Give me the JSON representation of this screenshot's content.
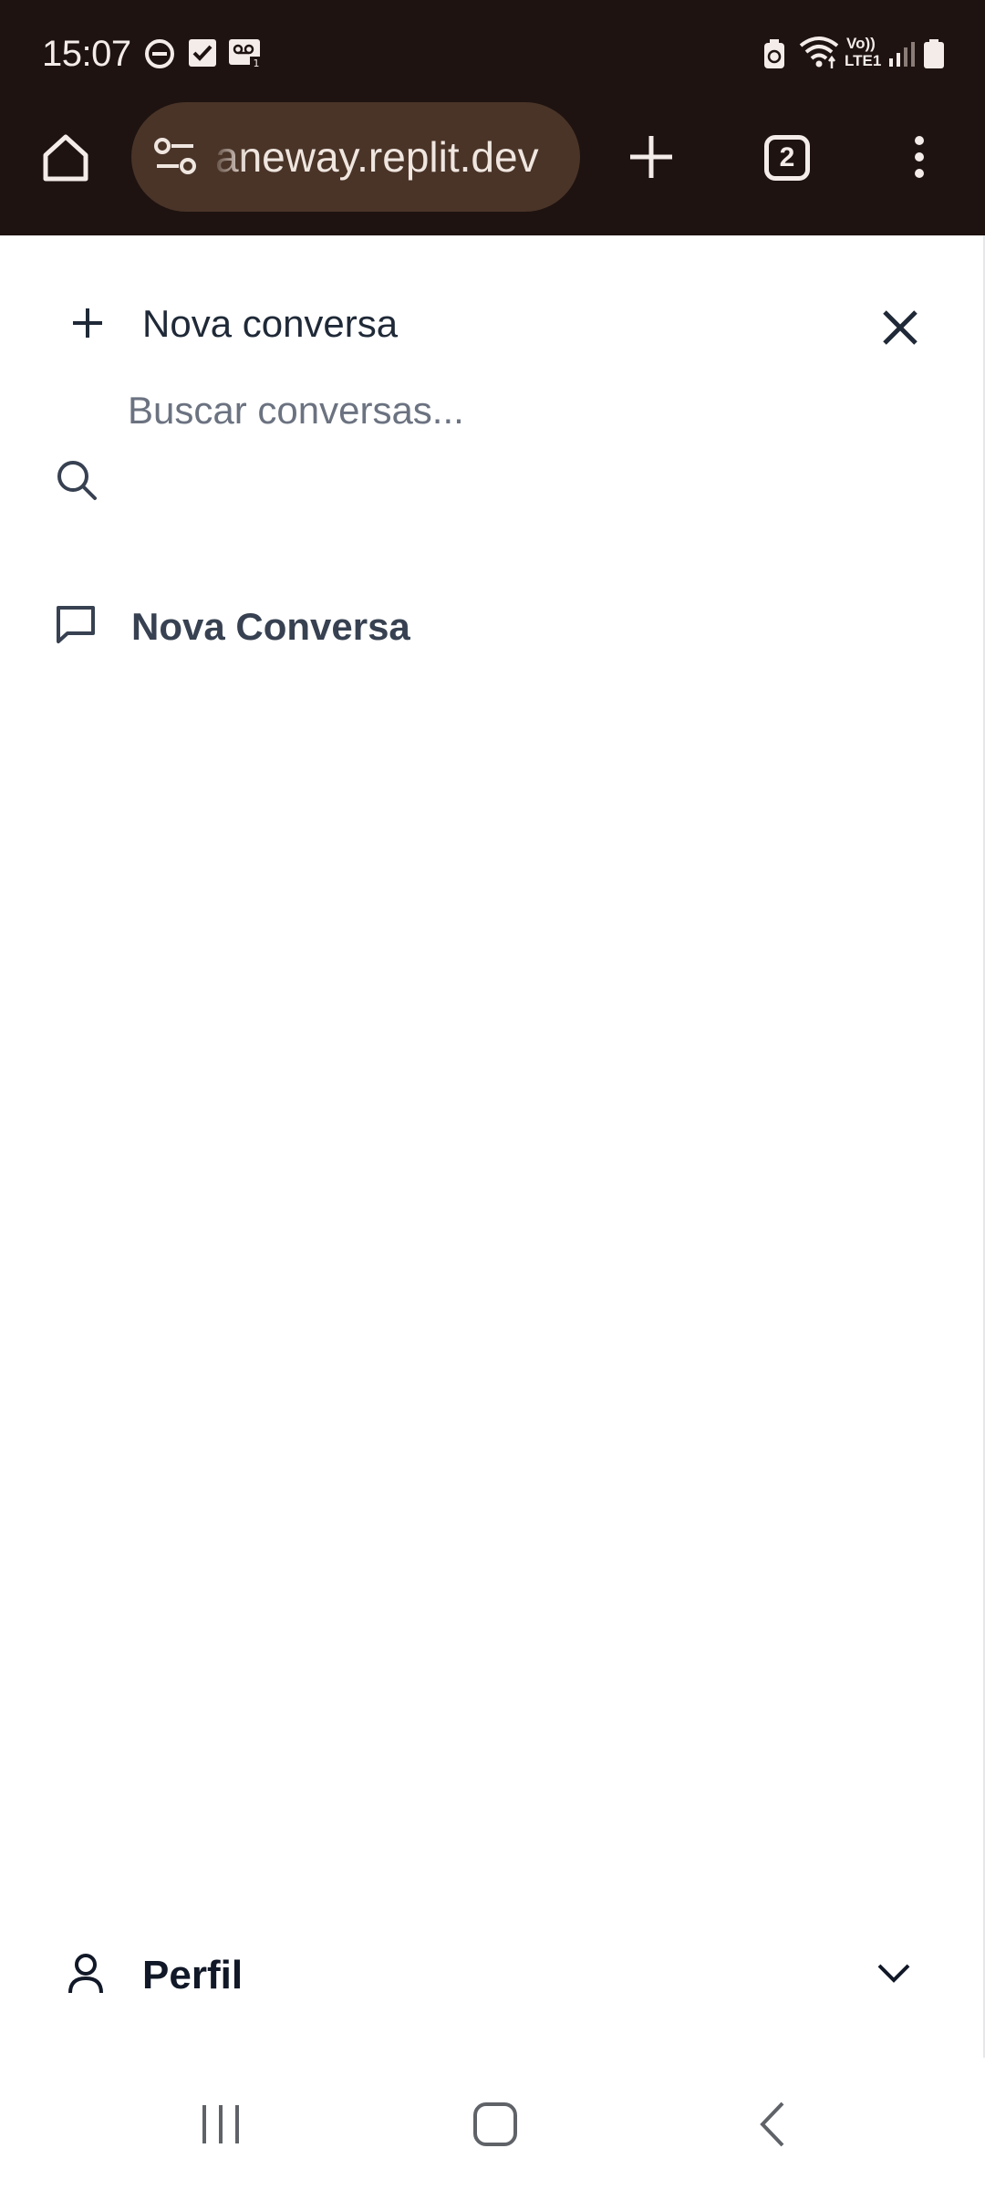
{
  "status_bar": {
    "time": "15:07",
    "left_icons": [
      "do-not-disturb-icon",
      "checkbox-notification-icon",
      "voicemail-icon"
    ],
    "right_icons": [
      "battery-saver-icon",
      "wifi-icon",
      "volte-icon",
      "signal-icon",
      "battery-icon"
    ],
    "network_label_top": "Vo))",
    "network_label_bottom": "LTE1"
  },
  "browser": {
    "url": "aneway.replit.dev",
    "tab_count": "2",
    "icons": [
      "home-icon",
      "site-settings-icon",
      "new-tab-icon",
      "tab-switcher-icon",
      "more-vert-icon"
    ]
  },
  "sidebar": {
    "new_chat_label": "Nova conversa",
    "search_placeholder": "Buscar conversas...",
    "conversations": [
      {
        "title": "Nova Conversa"
      }
    ],
    "profile_label": "Perfil"
  },
  "nav_bar": {
    "icons": [
      "recent-apps-icon",
      "home-button-icon",
      "back-icon"
    ]
  },
  "colors": {
    "chrome_bg": "#1e1310",
    "urlbar_bg": "#4a3428",
    "text_dark": "#1f2937",
    "text_muted": "#6b7280"
  }
}
